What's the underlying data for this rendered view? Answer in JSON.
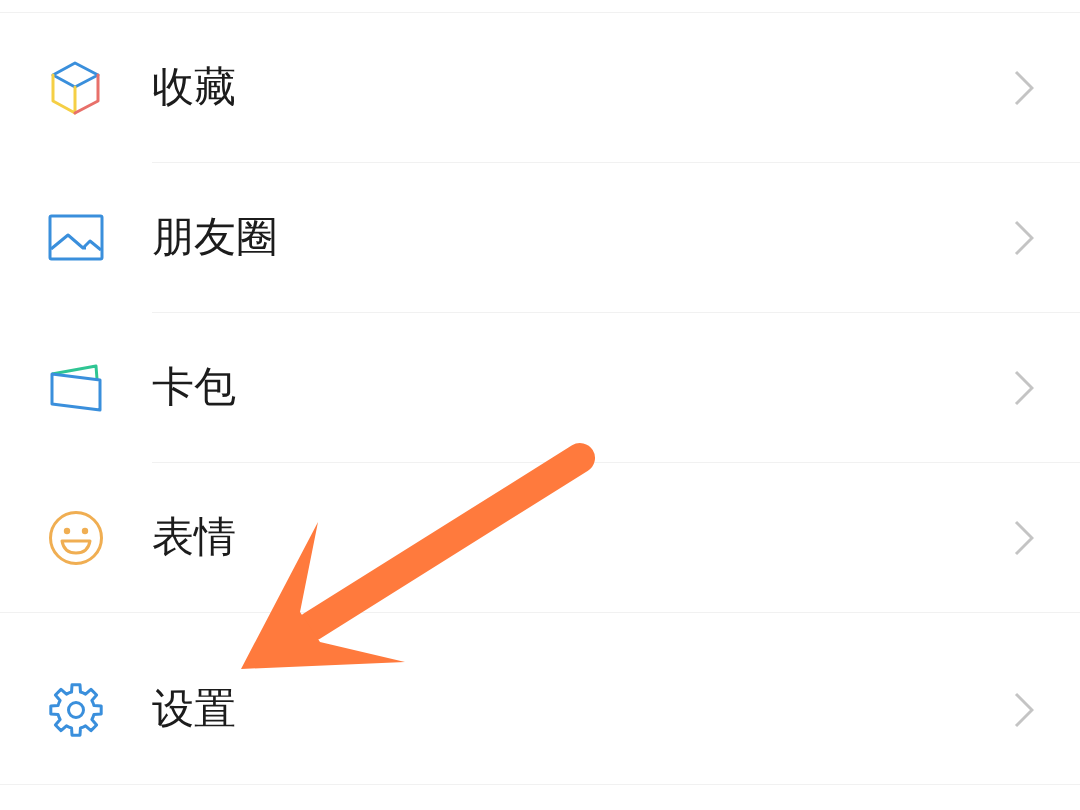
{
  "menu": {
    "groups": [
      {
        "items": [
          {
            "kind": "favorites",
            "label": "收藏"
          },
          {
            "kind": "moments",
            "label": "朋友圈"
          },
          {
            "kind": "cards",
            "label": "卡包"
          },
          {
            "kind": "stickers",
            "label": "表情"
          }
        ]
      },
      {
        "items": [
          {
            "kind": "settings",
            "label": "设置"
          }
        ]
      }
    ]
  }
}
